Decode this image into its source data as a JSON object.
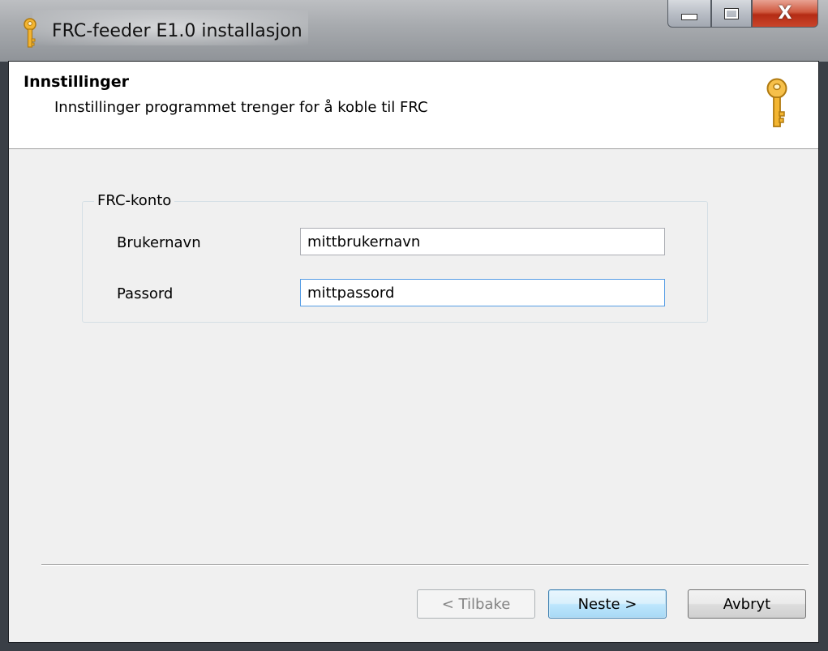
{
  "window": {
    "title": "FRC-feeder E1.0 installasjon",
    "close_glyph": "X",
    "title_icon": "key-icon"
  },
  "header": {
    "title": "Innstillinger",
    "subtitle": "Innstillinger programmet trenger for å koble til FRC",
    "icon": "key-icon"
  },
  "account_group": {
    "legend": "FRC-konto",
    "username_label": "Brukernavn",
    "username_value": "mittbrukernavn",
    "password_label": "Passord",
    "password_value": "mittpassord"
  },
  "buttons": {
    "back": "< Tilbake",
    "next": "Neste >",
    "cancel": "Avbryt"
  },
  "colors": {
    "key": "#f3b531",
    "close_button": "#c9452a",
    "default_button_border": "#3c7fb1"
  }
}
